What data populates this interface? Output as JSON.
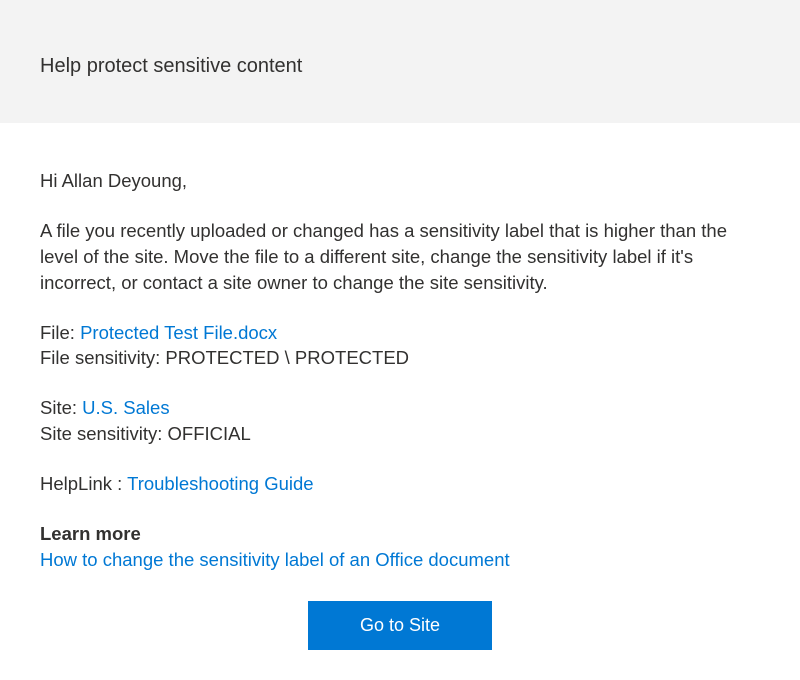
{
  "header": {
    "title": "Help protect sensitive content"
  },
  "greeting": "Hi Allan Deyoung,",
  "description": "A file you recently uploaded or changed has a sensitivity label that is higher than the level of the site. Move the file to a different site, change the sensitivity label if it's incorrect, or contact a site owner to change the site sensitivity.",
  "file": {
    "label": "File: ",
    "link": "Protected Test File.docx",
    "sensitivity_label": "File sensitivity: ",
    "sensitivity_value": "PROTECTED \\ PROTECTED"
  },
  "site": {
    "label": "Site: ",
    "link": "U.S. Sales",
    "sensitivity_label": "Site sensitivity: ",
    "sensitivity_value": "OFFICIAL"
  },
  "help": {
    "label": "HelpLink : ",
    "link": "Troubleshooting Guide"
  },
  "learn": {
    "heading": "Learn more",
    "link": "How to change the sensitivity label of an Office document"
  },
  "button": {
    "label": "Go to Site"
  }
}
